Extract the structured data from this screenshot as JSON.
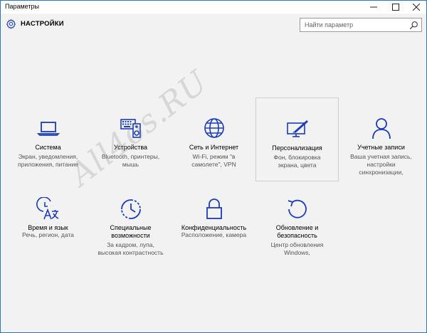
{
  "window": {
    "title": "Параметры"
  },
  "header": {
    "title": "НАСТРОЙКИ",
    "search_placeholder": "Найти параметр"
  },
  "accent": "#1a3cba",
  "tiles": [
    {
      "name": "Система",
      "desc": [
        "Экран, уведомления,",
        "приложения, питание"
      ],
      "icon": "laptop-icon"
    },
    {
      "name": "Устройства",
      "desc": [
        "Bluetooth, принтеры,",
        "мышь"
      ],
      "icon": "keyboard-speaker-icon"
    },
    {
      "name": "Сеть и Интернет",
      "desc": [
        "Wi-Fi, режим \"в",
        "самолете\", VPN"
      ],
      "icon": "globe-icon"
    },
    {
      "name": "Персонализация",
      "desc": [
        "Фон, блокировка",
        "экрана, цвета"
      ],
      "icon": "monitor-pen-icon"
    },
    {
      "name": "Учетные записи",
      "desc": [
        "Ваша учетная запись,",
        "настройки",
        "синхронизации,"
      ],
      "icon": "person-icon"
    },
    {
      "name": "Время и язык",
      "desc": [
        "Речь, регион, дата"
      ],
      "icon": "clock-language-icon"
    },
    {
      "name": "Специальные",
      "name2": "возможности",
      "desc": [
        "За кадром, лупа,",
        "высокая контрастность"
      ],
      "icon": "accessibility-icon"
    },
    {
      "name": "Конфиденциальность",
      "desc": [
        "Расположение, камера"
      ],
      "icon": "lock-icon"
    },
    {
      "name": "Обновление и",
      "name2": "безопасность",
      "desc": [
        "Центр обновления",
        "Windows,"
      ],
      "icon": "update-icon"
    }
  ],
  "watermark": "All4os.RU"
}
